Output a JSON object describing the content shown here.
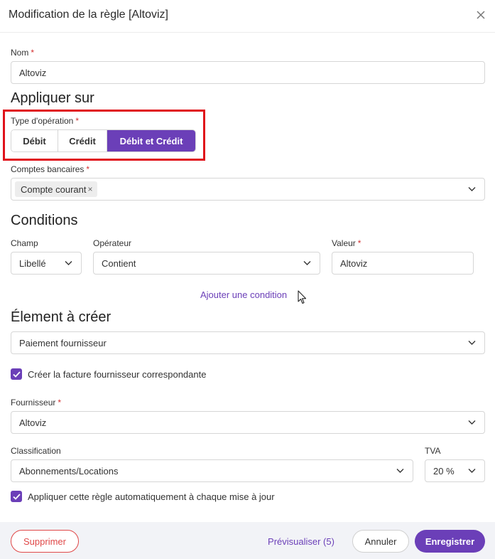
{
  "modal": {
    "title": "Modification de la règle [Altoviz]"
  },
  "name_field": {
    "label": "Nom",
    "required": "*",
    "value": "Altoviz"
  },
  "apply_on": {
    "section_title": "Appliquer sur",
    "operation_type": {
      "label": "Type d'opération",
      "required": "*",
      "options": [
        "Débit",
        "Crédit",
        "Débit et Crédit"
      ],
      "selected": "Débit et Crédit"
    },
    "bank_accounts": {
      "label": "Comptes bancaires",
      "required": "*",
      "chips": [
        "Compte courant"
      ],
      "chip_remove": "×"
    }
  },
  "conditions": {
    "section_title": "Conditions",
    "field": {
      "label": "Champ",
      "value": "Libellé"
    },
    "operator": {
      "label": "Opérateur",
      "value": "Contient"
    },
    "value": {
      "label": "Valeur",
      "required": "*",
      "value": "Altoviz"
    },
    "add_link": "Ajouter une condition"
  },
  "element": {
    "section_title": "Élement à créer",
    "type": {
      "value": "Paiement fournisseur"
    },
    "create_invoice": {
      "label": "Créer la facture fournisseur correspondante",
      "checked": true
    },
    "supplier": {
      "label": "Fournisseur",
      "required": "*",
      "value": "Altoviz"
    },
    "classification": {
      "label": "Classification",
      "value": "Abonnements/Locations"
    },
    "vat": {
      "label": "TVA",
      "value": "20 %"
    },
    "auto_apply": {
      "label": "Appliquer cette règle automatiquement à chaque mise à jour",
      "checked": true
    }
  },
  "footer": {
    "delete": "Supprimer",
    "preview": "Prévisualiser (5)",
    "cancel": "Annuler",
    "save": "Enregistrer"
  },
  "colors": {
    "accent": "#6b3fb8",
    "danger": "#e04848",
    "highlight": "#e0121a",
    "required": "#d32f2f"
  }
}
